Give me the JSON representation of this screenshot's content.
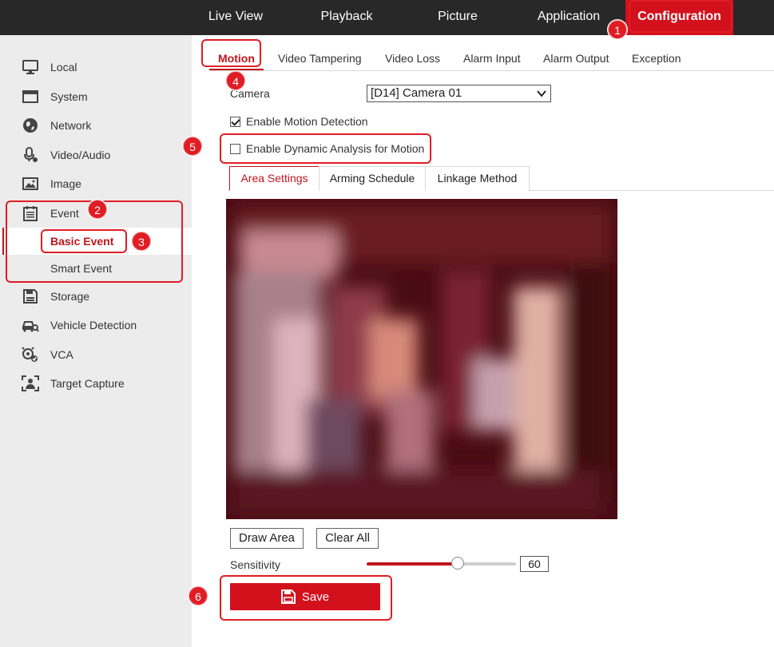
{
  "top_nav": [
    {
      "label": "Live View"
    },
    {
      "label": "Playback"
    },
    {
      "label": "Picture"
    },
    {
      "label": "Application"
    },
    {
      "label": "Configuration",
      "active": true
    }
  ],
  "sidebar": {
    "items": [
      {
        "label": "Local",
        "icon": "monitor-icon"
      },
      {
        "label": "System",
        "icon": "window-icon"
      },
      {
        "label": "Network",
        "icon": "globe-icon"
      },
      {
        "label": "Video/Audio",
        "icon": "microphone-icon"
      },
      {
        "label": "Image",
        "icon": "image-icon"
      },
      {
        "label": "Event",
        "icon": "calendar-icon"
      },
      {
        "label": "Storage",
        "icon": "floppy-icon"
      },
      {
        "label": "Vehicle Detection",
        "icon": "car-search-icon"
      },
      {
        "label": "VCA",
        "icon": "vca-icon"
      },
      {
        "label": "Target Capture",
        "icon": "target-capture-icon"
      }
    ],
    "event_sub": [
      {
        "label": "Basic Event",
        "active": true
      },
      {
        "label": "Smart Event"
      }
    ]
  },
  "sub_tabs": [
    {
      "label": "Motion",
      "active": true
    },
    {
      "label": "Video Tampering"
    },
    {
      "label": "Video Loss"
    },
    {
      "label": "Alarm Input"
    },
    {
      "label": "Alarm Output"
    },
    {
      "label": "Exception"
    }
  ],
  "form": {
    "camera_label": "Camera",
    "camera_value": "[D14] Camera 01",
    "enable_motion_label": "Enable Motion Detection",
    "enable_motion_checked": true,
    "enable_dynamic_label": "Enable Dynamic Analysis for Motion",
    "enable_dynamic_checked": false
  },
  "inner_tabs": [
    {
      "label": "Area Settings",
      "active": true
    },
    {
      "label": "Arming Schedule"
    },
    {
      "label": "Linkage Method"
    }
  ],
  "buttons": {
    "draw_area": "Draw Area",
    "clear_all": "Clear All",
    "save": "Save"
  },
  "sensitivity": {
    "label": "Sensitivity",
    "value": "60",
    "fraction": 0.6
  },
  "annotations": [
    {
      "number": "1"
    },
    {
      "number": "2"
    },
    {
      "number": "3"
    },
    {
      "number": "4"
    },
    {
      "number": "5"
    },
    {
      "number": "6"
    }
  ],
  "colors": {
    "accent": "#d3111c",
    "topbar": "#282828",
    "sidebar": "#ececec",
    "annotation": "#e01d25"
  }
}
